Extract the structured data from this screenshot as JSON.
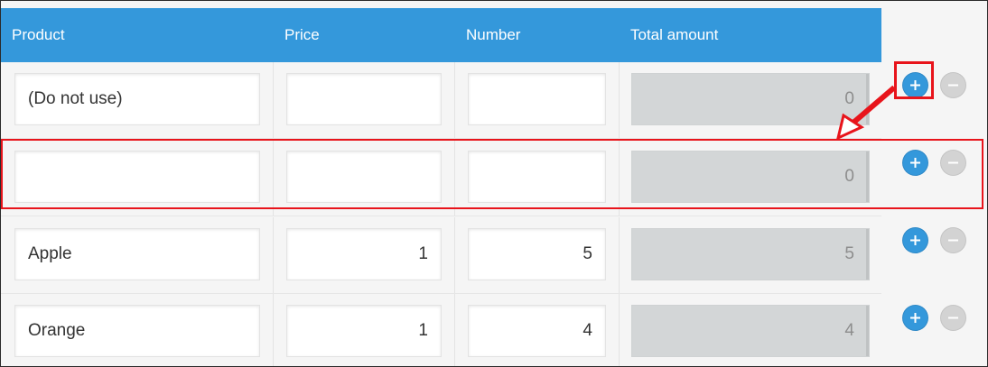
{
  "table": {
    "columns": [
      "Product",
      "Price",
      "Number",
      "Total amount"
    ],
    "rows": [
      {
        "product": "(Do not use)",
        "price": "",
        "number": "",
        "total": "0"
      },
      {
        "product": "",
        "price": "",
        "number": "",
        "total": "0"
      },
      {
        "product": "Apple",
        "price": "1",
        "number": "5",
        "total": "5"
      },
      {
        "product": "Orange",
        "price": "1",
        "number": "4",
        "total": "4"
      }
    ]
  },
  "row_actions": {
    "add_icon": "plus-icon",
    "remove_icon": "minus-icon"
  },
  "colors": {
    "header_bg": "#3498db",
    "add_button": "#3498db",
    "remove_button": "#d3d3d3",
    "annotation": "#e8141b"
  }
}
